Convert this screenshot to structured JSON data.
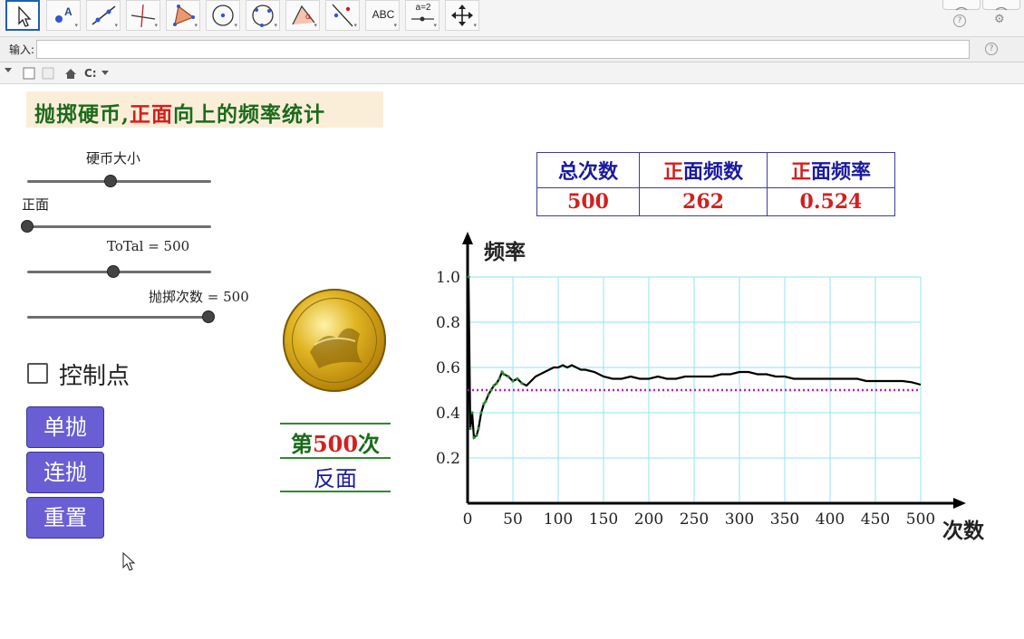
{
  "toolbar": {
    "tools": [
      {
        "icon": "move-arrow-icon"
      },
      {
        "icon": "point-icon"
      },
      {
        "icon": "line-icon"
      },
      {
        "icon": "perpendicular-line-icon"
      },
      {
        "icon": "polygon-icon"
      },
      {
        "icon": "circle-center-point-icon"
      },
      {
        "icon": "circle-three-points-icon"
      },
      {
        "icon": "angle-icon"
      },
      {
        "icon": "reflect-icon"
      },
      {
        "icon": "text-tool-icon",
        "label": "ABC"
      },
      {
        "icon": "slider-tool-icon",
        "label": "a=2"
      },
      {
        "icon": "move-view-icon"
      }
    ]
  },
  "input_bar": {
    "label": "输入:",
    "value": ""
  },
  "canvas": {
    "title": {
      "part1": "抛掷硬币,",
      "part2": "正面",
      "part3": "向上的频率统计"
    },
    "sliders": [
      {
        "label": "硬币大小",
        "fraction": 0.45
      },
      {
        "label": "正面",
        "fraction": 0.0
      },
      {
        "label": "ToTal = 500",
        "fraction": 0.47
      },
      {
        "label": "抛掷次数 = 500",
        "fraction": 1.0
      }
    ],
    "checkbox": {
      "label": "控制点",
      "checked": false
    },
    "buttons": [
      "单抛",
      "连抛",
      "重置"
    ],
    "throw_count": {
      "prefix": "第",
      "number": "500",
      "suffix": "次"
    },
    "result": "反面",
    "stats_table": {
      "headers": [
        {
          "plain": "总次数",
          "red": ""
        },
        {
          "plain": "面频数",
          "red": "正"
        },
        {
          "plain": "面频率",
          "red": "正"
        }
      ],
      "values": [
        "500",
        "262",
        "0.524"
      ]
    }
  },
  "chart_data": {
    "type": "line",
    "ylabel": "频率",
    "xlabel": "次数",
    "x_ticks": [
      "0",
      "50",
      "100",
      "150",
      "200",
      "250",
      "300",
      "350",
      "400",
      "450",
      "500"
    ],
    "y_ticks": [
      "0.2",
      "0.4",
      "0.6",
      "0.8",
      "1.0"
    ],
    "xlim": [
      0,
      500
    ],
    "ylim": [
      0,
      1.0
    ],
    "grid": true,
    "reference_line": {
      "y": 0.5,
      "style": "dotted",
      "color": "#c020c0"
    },
    "series": [
      {
        "color": "#000000",
        "points": [
          [
            1,
            1.0
          ],
          [
            3,
            0.33
          ],
          [
            5,
            0.4
          ],
          [
            7,
            0.29
          ],
          [
            10,
            0.3
          ],
          [
            12,
            0.33
          ],
          [
            15,
            0.4
          ],
          [
            18,
            0.44
          ],
          [
            20,
            0.45
          ],
          [
            23,
            0.48
          ],
          [
            26,
            0.5
          ],
          [
            29,
            0.52
          ],
          [
            32,
            0.53
          ],
          [
            35,
            0.55
          ],
          [
            38,
            0.58
          ],
          [
            40,
            0.57
          ],
          [
            45,
            0.56
          ],
          [
            50,
            0.54
          ],
          [
            55,
            0.55
          ],
          [
            60,
            0.53
          ],
          [
            65,
            0.52
          ],
          [
            70,
            0.54
          ],
          [
            75,
            0.56
          ],
          [
            80,
            0.57
          ],
          [
            85,
            0.58
          ],
          [
            90,
            0.59
          ],
          [
            95,
            0.6
          ],
          [
            100,
            0.6
          ],
          [
            105,
            0.61
          ],
          [
            110,
            0.6
          ],
          [
            115,
            0.61
          ],
          [
            120,
            0.6
          ],
          [
            125,
            0.59
          ],
          [
            130,
            0.59
          ],
          [
            140,
            0.58
          ],
          [
            150,
            0.56
          ],
          [
            160,
            0.55
          ],
          [
            170,
            0.55
          ],
          [
            180,
            0.56
          ],
          [
            190,
            0.55
          ],
          [
            200,
            0.55
          ],
          [
            210,
            0.56
          ],
          [
            220,
            0.55
          ],
          [
            230,
            0.55
          ],
          [
            240,
            0.56
          ],
          [
            250,
            0.56
          ],
          [
            260,
            0.56
          ],
          [
            270,
            0.56
          ],
          [
            280,
            0.57
          ],
          [
            290,
            0.57
          ],
          [
            300,
            0.58
          ],
          [
            310,
            0.58
          ],
          [
            320,
            0.57
          ],
          [
            330,
            0.57
          ],
          [
            340,
            0.56
          ],
          [
            350,
            0.56
          ],
          [
            360,
            0.55
          ],
          [
            370,
            0.55
          ],
          [
            380,
            0.55
          ],
          [
            390,
            0.55
          ],
          [
            400,
            0.55
          ],
          [
            410,
            0.55
          ],
          [
            420,
            0.55
          ],
          [
            430,
            0.55
          ],
          [
            440,
            0.54
          ],
          [
            450,
            0.54
          ],
          [
            460,
            0.54
          ],
          [
            470,
            0.54
          ],
          [
            480,
            0.54
          ],
          [
            490,
            0.535
          ],
          [
            500,
            0.524
          ]
        ]
      }
    ]
  },
  "colors": {
    "title_green": "#1b6b1b",
    "title_red": "#d2201e",
    "table_blue": "#1a1aa0",
    "button_purple": "#6a5ed4",
    "grid_cyan": "#8fe4f0"
  }
}
